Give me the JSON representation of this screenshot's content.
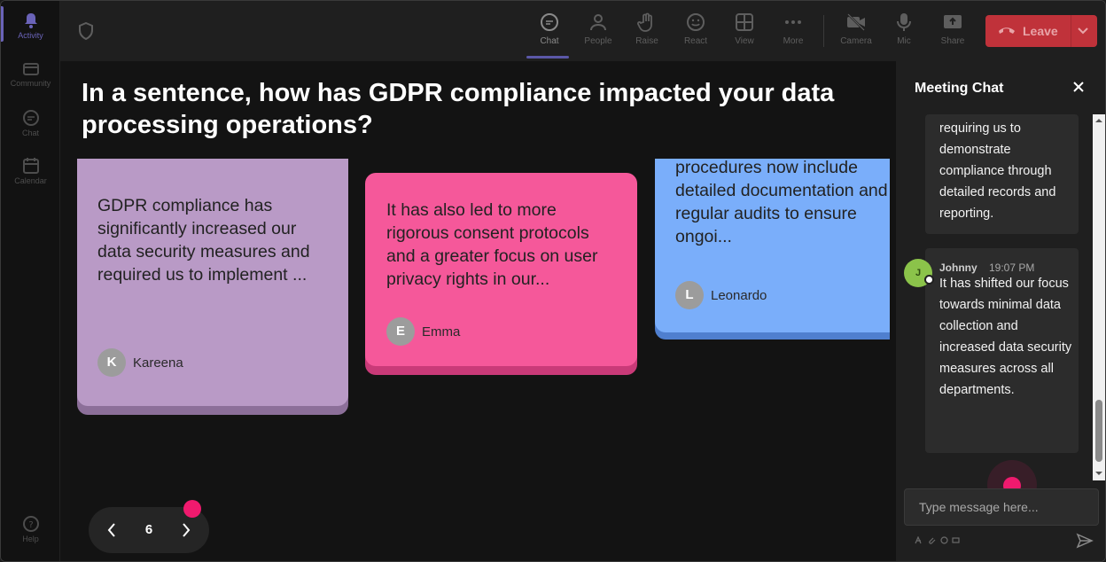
{
  "rail": {
    "items": [
      {
        "label": "Activity",
        "icon": "bell-icon"
      },
      {
        "label": "Community",
        "icon": "community-icon"
      },
      {
        "label": "Chat",
        "icon": "chat-icon"
      },
      {
        "label": "Calendar",
        "icon": "calendar-icon"
      }
    ],
    "help": {
      "label": "Help",
      "icon": "help-icon"
    }
  },
  "toolbar": {
    "items": [
      {
        "label": "Chat",
        "icon": "chat-icon"
      },
      {
        "label": "People",
        "icon": "people-icon"
      },
      {
        "label": "Raise",
        "icon": "raise-hand-icon"
      },
      {
        "label": "React",
        "icon": "smiley-icon"
      },
      {
        "label": "View",
        "icon": "grid-icon"
      },
      {
        "label": "More",
        "icon": "more-icon"
      },
      {
        "label": "Camera",
        "icon": "camera-off-icon"
      },
      {
        "label": "Mic",
        "icon": "mic-icon"
      },
      {
        "label": "Share",
        "icon": "share-icon"
      }
    ],
    "leave_label": "Leave"
  },
  "main": {
    "question": "In a sentence, how has GDPR compliance impacted your data processing operations?",
    "cards": [
      {
        "text": "GDPR compliance has significantly increased our data security measures and required us to implement ...",
        "initial": "K",
        "author": "Kareena"
      },
      {
        "text": "It has also led to more rigorous consent protocols and a greater focus on user privacy rights in our...",
        "initial": "E",
        "author": "Emma"
      },
      {
        "text": "procedures now include detailed documentation and regular audits to ensure ongoi...",
        "initial": "L",
        "author": "Leonardo"
      }
    ],
    "page_number": "6"
  },
  "chat": {
    "title": "Meeting Chat",
    "messages": [
      {
        "text": "requiring us to demonstrate compliance through detailed records and reporting."
      },
      {
        "sender": "Johnny",
        "initial": "J",
        "time": "19:07 PM",
        "text": "It has shifted our focus towards minimal data collection and increased data security measures across all departments."
      }
    ],
    "input_placeholder": "Type message here..."
  },
  "colors": {
    "card_purple": "#b99ac6",
    "card_pink": "#f5589a",
    "card_blue": "#7aaefa",
    "leave_red": "#c0323a",
    "accent_dot": "#f01a6e"
  }
}
